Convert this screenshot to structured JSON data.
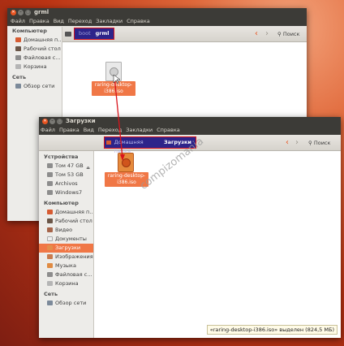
{
  "win1": {
    "title": "grml",
    "menu": [
      "Файл",
      "Правка",
      "Вид",
      "Переход",
      "Закладки",
      "Справка"
    ],
    "crumbs": [
      "boot",
      "grml"
    ],
    "search_label": "Поиск",
    "sidebar": {
      "computer_header": "Компьютер",
      "computer_items": [
        {
          "label": "Домашняя п…",
          "icon": "home-icon"
        },
        {
          "label": "Рабочий стол",
          "icon": "desktop-icon"
        },
        {
          "label": "Файловая с…",
          "icon": "filesystem-icon"
        },
        {
          "label": "Корзина",
          "icon": "trash-icon"
        }
      ],
      "network_header": "Сеть",
      "network_items": [
        {
          "label": "Обзор сети",
          "icon": "network-icon"
        }
      ]
    },
    "file": {
      "name": "raring-desktop-i386.iso",
      "label_line1": "raring-desktop-",
      "label_line2": "i386.iso"
    }
  },
  "win2": {
    "title": "Загрузки",
    "menu": [
      "Файл",
      "Правка",
      "Вид",
      "Переход",
      "Закладки",
      "Справка"
    ],
    "crumbs": [
      "Домашняя папка",
      "Загрузки"
    ],
    "search_label": "Поиск",
    "sidebar": {
      "devices_header": "Устройства",
      "devices_items": [
        {
          "label": "Том 47 GB",
          "icon": "drive-icon"
        },
        {
          "label": "Том 53 GB",
          "icon": "drive-icon"
        },
        {
          "label": "Archivos",
          "icon": "drive-icon"
        },
        {
          "label": "Windows7",
          "icon": "drive-icon"
        }
      ],
      "computer_header": "Компьютер",
      "computer_items": [
        {
          "label": "Домашняя п…",
          "icon": "home-icon"
        },
        {
          "label": "Рабочий стол",
          "icon": "desktop-icon"
        },
        {
          "label": "Видео",
          "icon": "video-icon"
        },
        {
          "label": "Документы",
          "icon": "documents-icon"
        },
        {
          "label": "Загрузки",
          "icon": "downloads-icon",
          "selected": true
        },
        {
          "label": "Изображения",
          "icon": "pictures-icon"
        },
        {
          "label": "Музыка",
          "icon": "music-icon"
        },
        {
          "label": "Файловая с…",
          "icon": "filesystem-icon"
        },
        {
          "label": "Корзина",
          "icon": "trash-icon"
        }
      ],
      "network_header": "Сеть",
      "network_items": [
        {
          "label": "Обзор сети",
          "icon": "network-icon"
        }
      ]
    },
    "file": {
      "name": "raring-desktop-i386.iso",
      "label_line1": "raring-desktop-",
      "label_line2": "i386.iso"
    },
    "status": "«raring-desktop-i386.iso» выделен (824,5 МБ)"
  },
  "watermark": "compizomania",
  "colors": {
    "accent": "#f07746",
    "highlight": "#d8141c",
    "crumb_bg": "#2d248a",
    "titlebar": "#3c3b37"
  }
}
